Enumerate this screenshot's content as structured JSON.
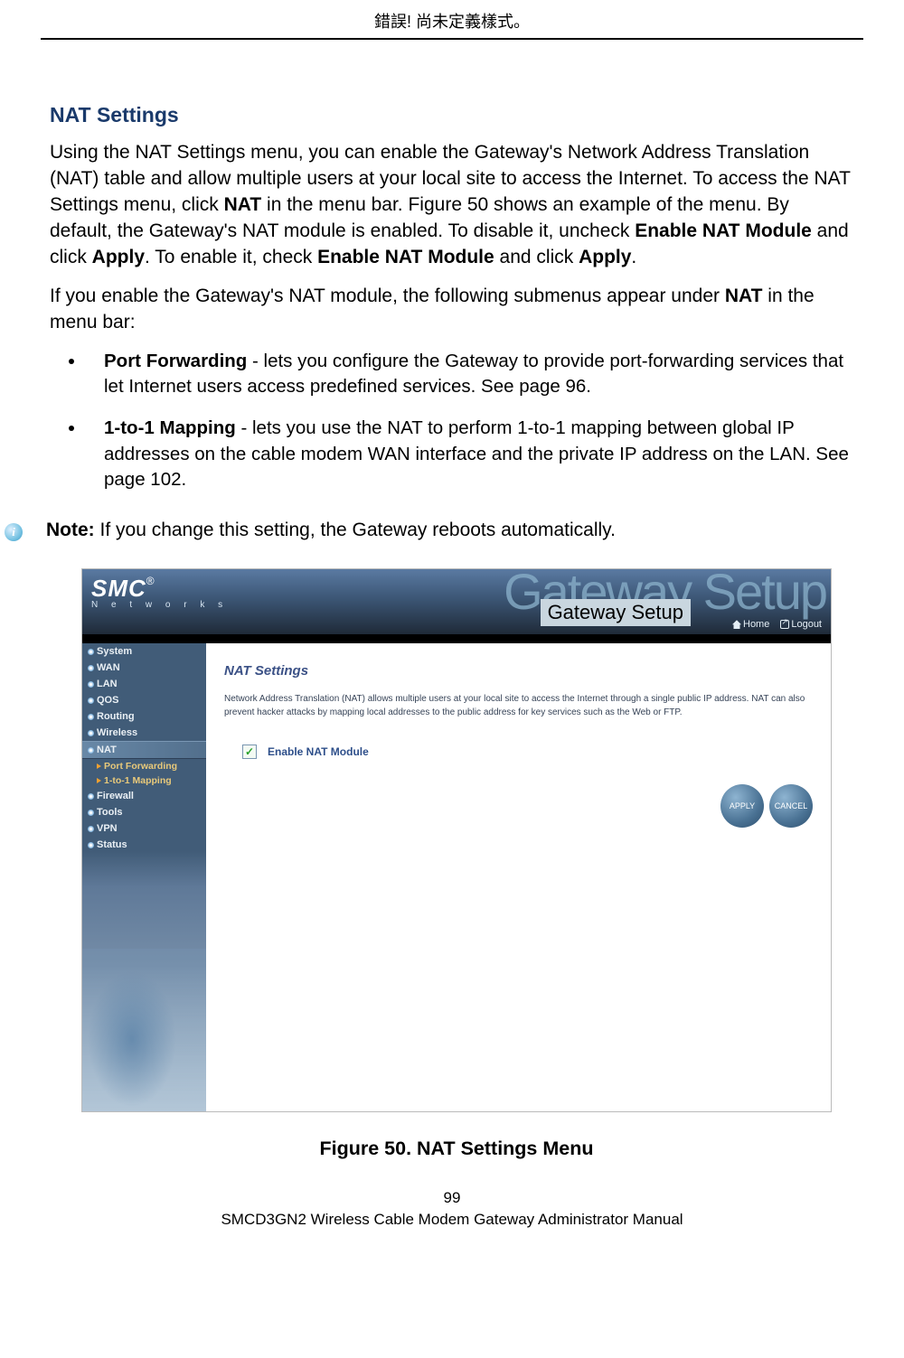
{
  "header_error": "錯誤! 尚未定義樣式。",
  "section_title": "NAT Settings",
  "para1_a": "Using the NAT Settings menu, you can enable the Gateway's Network Address Translation (NAT) table and allow multiple users at your local site to access the Internet. To access the NAT Settings menu, click ",
  "para1_b": "NAT",
  "para1_c": " in the menu bar. Figure 50 shows an example of the menu. By default, the Gateway's NAT module is enabled. To disable it, uncheck ",
  "para1_d": "Enable NAT Module",
  "para1_e": " and click ",
  "para1_f": "Apply",
  "para1_g": ". To enable it, check ",
  "para1_h": "Enable NAT Module",
  "para1_i": " and click ",
  "para1_j": "Apply",
  "para1_k": ".",
  "para2_a": "If you enable the Gateway's NAT module, the following submenus appear under ",
  "para2_b": "NAT",
  "para2_c": " in the menu bar:",
  "bullet1_b": "Port Forwarding",
  "bullet1_t": " - lets you configure the Gateway to provide port-forwarding services that let Internet users access predefined services. See page 96.",
  "bullet2_b": "1-to-1 Mapping",
  "bullet2_t": " - lets you use the NAT to perform 1-to-1 mapping between global IP addresses on the cable modem WAN interface and the private IP address on the LAN. See page 102.",
  "note_b": "Note:",
  "note_t": " If you change this setting, the Gateway reboots automatically.",
  "fig": {
    "logo": "SMC",
    "reg": "®",
    "networks": "N e t w o r k s",
    "gw_bg": "Gateway Setup",
    "gw_ov": "Gateway Setup",
    "home": "Home",
    "logout": "Logout",
    "nav": [
      "System",
      "WAN",
      "LAN",
      "QOS",
      "Routing",
      "Wireless",
      "NAT"
    ],
    "subnav": [
      "Port Forwarding",
      "1-to-1 Mapping"
    ],
    "nav_after": [
      "Firewall",
      "Tools",
      "VPN",
      "Status"
    ],
    "panel_title": "NAT Settings",
    "panel_desc": "Network Address Translation (NAT) allows multiple users at your local site to access the Internet through a single public IP address. NAT can also prevent hacker attacks by mapping local addresses to the public address for key services such as the Web or FTP.",
    "enable_label": "Enable NAT Module",
    "apply": "APPLY",
    "cancel": "CANCEL"
  },
  "figure_caption": "Figure 50. NAT Settings Menu",
  "page_num": "99",
  "footer": "SMCD3GN2 Wireless Cable Modem Gateway Administrator Manual"
}
